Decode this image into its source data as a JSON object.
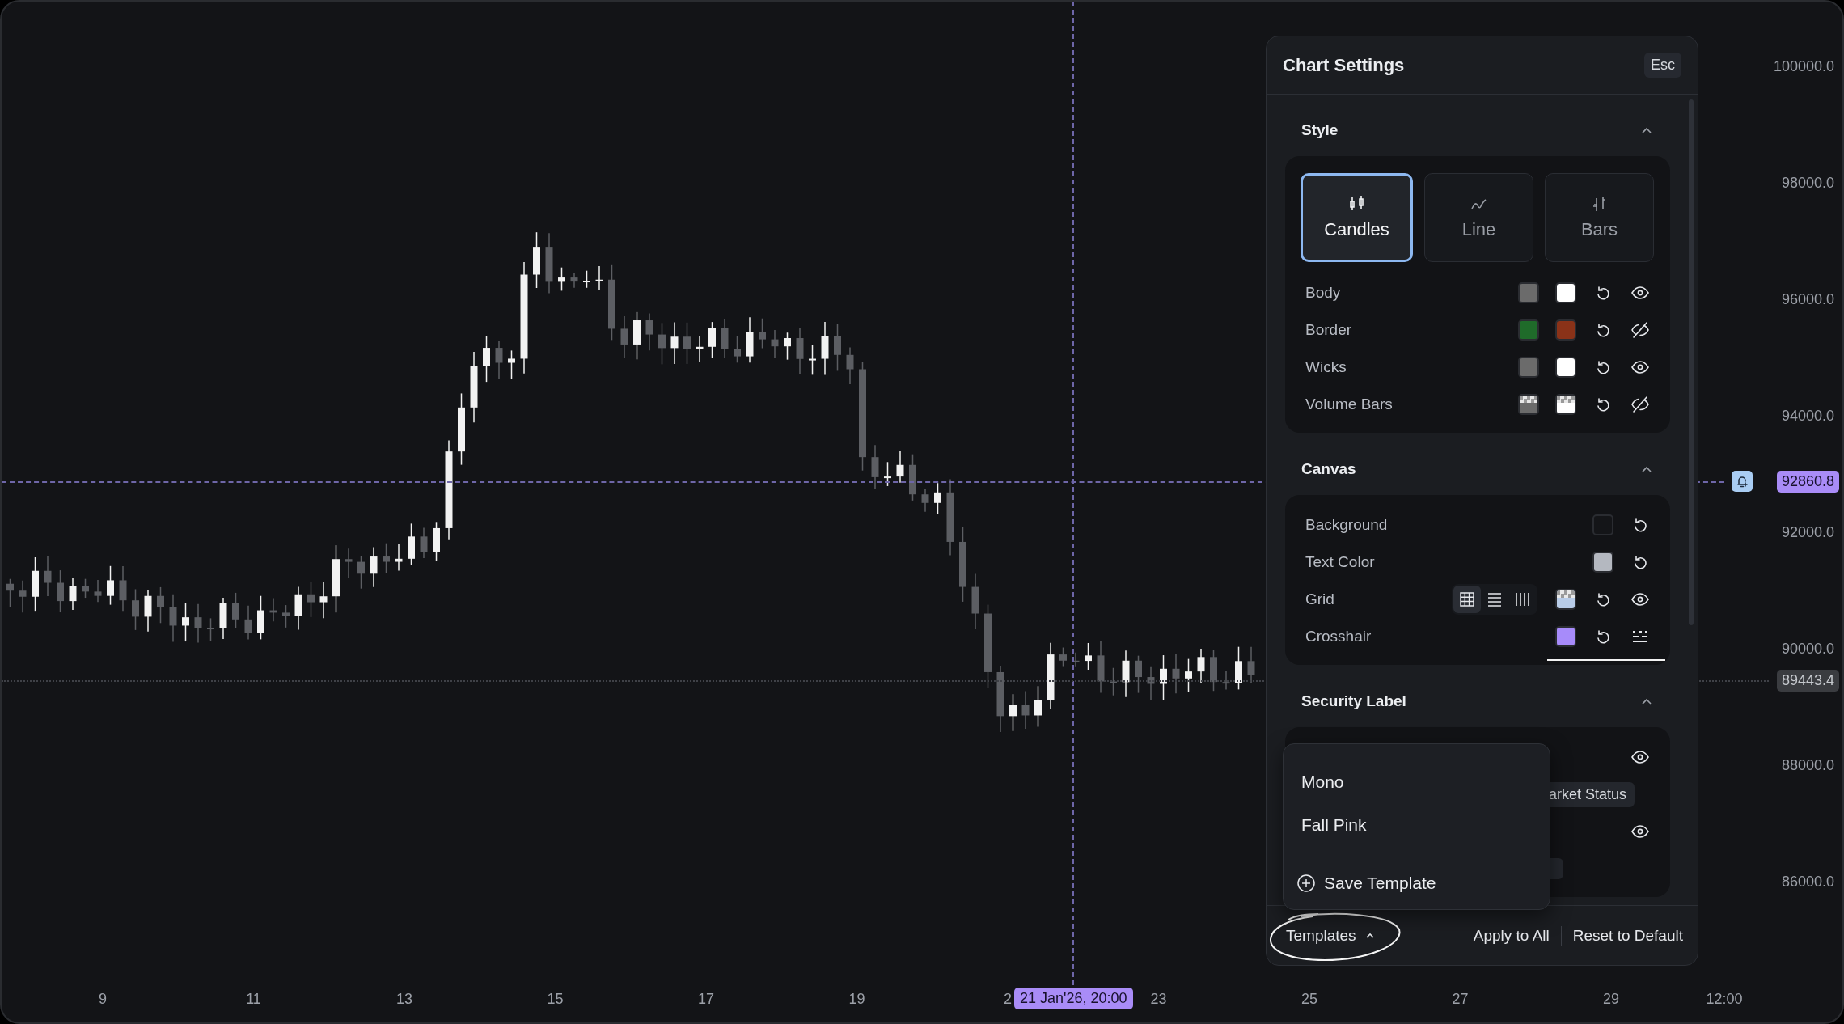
{
  "chart": {
    "price_ticks": [
      "100000.0",
      "98000.0",
      "96000.0",
      "94000.0",
      "92000.0",
      "90000.0",
      "88000.0",
      "86000.0"
    ],
    "time_ticks": [
      "9",
      "11",
      "13",
      "15",
      "17",
      "19",
      "2",
      "23",
      "25",
      "27",
      "29",
      "12:00"
    ],
    "crosshair": {
      "price": "92860.8",
      "time": "21 Jan'26, 20:00"
    },
    "last_price": "89443.4"
  },
  "settings": {
    "title": "Chart Settings",
    "close_key": "Esc",
    "sections": [
      {
        "title": "Style",
        "expanded": true,
        "style_options": [
          {
            "label": "Candles",
            "kind": "candles",
            "selected": true
          },
          {
            "label": "Line",
            "kind": "line",
            "selected": false
          },
          {
            "label": "Bars",
            "kind": "bars",
            "selected": false
          }
        ],
        "rows": [
          {
            "label": "Body",
            "controls": [
              {
                "kind": "swatch",
                "color": "#6b6b6b"
              },
              {
                "kind": "swatch",
                "color": "#ffffff"
              },
              {
                "kind": "reset"
              },
              {
                "kind": "visibility",
                "visible": true
              }
            ]
          },
          {
            "label": "Border",
            "controls": [
              {
                "kind": "swatch",
                "color": "#1f6b2a"
              },
              {
                "kind": "swatch",
                "color": "#8a3218"
              },
              {
                "kind": "reset"
              },
              {
                "kind": "visibility",
                "visible": false
              }
            ]
          },
          {
            "label": "Wicks",
            "controls": [
              {
                "kind": "swatch",
                "color": "#6b6b6b"
              },
              {
                "kind": "swatch",
                "color": "#ffffff"
              },
              {
                "kind": "reset"
              },
              {
                "kind": "visibility",
                "visible": true
              }
            ]
          },
          {
            "label": "Volume Bars",
            "controls": [
              {
                "kind": "alpha-swatch",
                "color": "#6b6b6b"
              },
              {
                "kind": "alpha-swatch",
                "color": "#ffffff"
              },
              {
                "kind": "reset"
              },
              {
                "kind": "visibility",
                "visible": false
              }
            ]
          }
        ]
      },
      {
        "title": "Canvas",
        "expanded": true,
        "rows": [
          {
            "label": "Background",
            "controls": [
              {
                "kind": "swatch",
                "color": "#141518"
              },
              {
                "kind": "reset"
              }
            ]
          },
          {
            "label": "Text Color",
            "controls": [
              {
                "kind": "swatch",
                "color": "#b4b8c0"
              },
              {
                "kind": "reset"
              }
            ]
          },
          {
            "label": "Grid",
            "controls": [
              {
                "kind": "grid-mode",
                "options": [
                  {
                    "kind": "both",
                    "selected": true
                  },
                  {
                    "kind": "horizontal",
                    "selected": false
                  },
                  {
                    "kind": "vertical",
                    "selected": false
                  }
                ]
              },
              {
                "kind": "alpha-swatch",
                "color": "#b8cce8"
              },
              {
                "kind": "reset"
              },
              {
                "kind": "visibility",
                "visible": true
              }
            ]
          },
          {
            "label": "Crosshair",
            "highlighted": true,
            "controls": [
              {
                "kind": "swatch",
                "color": "#a78bfa"
              },
              {
                "kind": "reset"
              },
              {
                "kind": "line-style"
              }
            ]
          }
        ]
      },
      {
        "title": "Security Label",
        "expanded": true,
        "rows": [
          {
            "controls": [
              {
                "kind": "visibility",
                "visible": true
              }
            ]
          },
          {
            "chip": "arket Status"
          },
          {
            "controls": [
              {
                "kind": "visibility",
                "visible": true
              }
            ]
          },
          {
            "chip_stub": true
          }
        ]
      }
    ]
  },
  "templates_menu": {
    "items": [
      {
        "label": "Mono"
      },
      {
        "label": "Fall Pink"
      }
    ],
    "save_label": "Save Template"
  },
  "footer": {
    "templates_label": "Templates",
    "menu_open": true,
    "apply_label": "Apply to All",
    "reset_label": "Reset to Default"
  }
}
